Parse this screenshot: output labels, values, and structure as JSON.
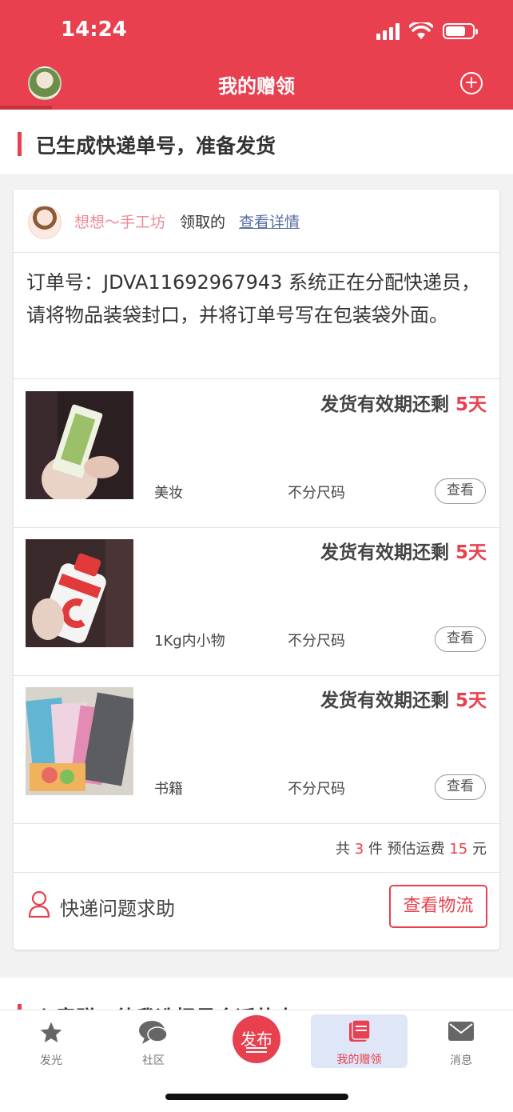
{
  "status": {
    "time": "14:24"
  },
  "header": {
    "title": "我的赠领"
  },
  "section": {
    "title": "已生成快递单号，准备发货"
  },
  "card": {
    "user_name": "想想～手工坊",
    "claimed_text": "领取的",
    "detail_link": "查看详情",
    "order_text": "订单号：JDVA11692967943 系统正在分配快递员，请将物品装袋封口，并将订单号写在包装袋外面。",
    "items": [
      {
        "deadline_prefix": "发货有效期还剩",
        "deadline_days": "5天",
        "category": "美妆",
        "size": "不分尺码",
        "view": "查看"
      },
      {
        "deadline_prefix": "发货有效期还剩",
        "deadline_days": "5天",
        "category": "1Kg内小物",
        "size": "不分尺码",
        "view": "查看"
      },
      {
        "deadline_prefix": "发货有效期还剩",
        "deadline_days": "5天",
        "category": "书籍",
        "size": "不分尺码",
        "view": "查看"
      }
    ],
    "summary": {
      "prefix": "共",
      "count": "3",
      "middle": "件 预估运费",
      "fee": "15",
      "suffix": "元"
    },
    "help_text": "快递问题求助",
    "logistics_button": "查看物流"
  },
  "next_section": {
    "title": "心意赠，待我选择最合适的人"
  },
  "tabbar": {
    "items": [
      {
        "label": "发光"
      },
      {
        "label": "社区"
      },
      {
        "label": "发布"
      },
      {
        "label": "我的赠领"
      },
      {
        "label": "消息"
      }
    ]
  },
  "colors": {
    "accent": "#e8404f",
    "link": "#5a6fa3"
  }
}
